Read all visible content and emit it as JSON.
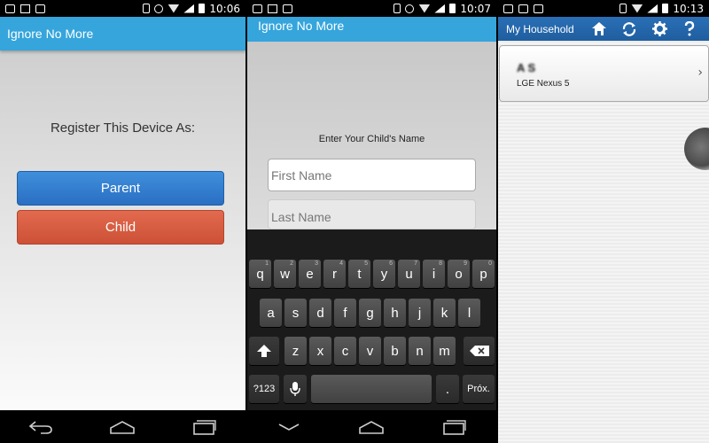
{
  "status_times": [
    "10:06",
    "10:07",
    "10:13"
  ],
  "screen1": {
    "app_title": "Ignore No More",
    "register_prompt": "Register This Device As:",
    "parent_label": "Parent",
    "child_label": "Child"
  },
  "screen2": {
    "app_title": "Ignore No More",
    "child_prompt": "Enter Your Child's Name",
    "first_placeholder": "First Name",
    "last_placeholder": "Last Name",
    "keyboard": {
      "row1": [
        [
          "q",
          "1"
        ],
        [
          "w",
          "2"
        ],
        [
          "e",
          "3"
        ],
        [
          "r",
          "4"
        ],
        [
          "t",
          "5"
        ],
        [
          "y",
          "6"
        ],
        [
          "u",
          "7"
        ],
        [
          "i",
          "8"
        ],
        [
          "o",
          "9"
        ],
        [
          "p",
          "0"
        ]
      ],
      "row2": [
        "a",
        "s",
        "d",
        "f",
        "g",
        "h",
        "j",
        "k",
        "l"
      ],
      "row3": [
        "z",
        "x",
        "c",
        "v",
        "b",
        "n",
        "m"
      ],
      "symbols_key": "?123",
      "period_key": ".",
      "next_key": "Próx."
    }
  },
  "screen3": {
    "title": "My Household",
    "device_name": "A      S   ",
    "device_model": "LGE Nexus 5"
  },
  "icons": {
    "home": "home-icon",
    "refresh": "refresh-icon",
    "settings": "gear-icon",
    "help": "help-icon",
    "back": "back-icon",
    "nav_home": "nav-home-icon",
    "recents": "recents-icon"
  },
  "colors": {
    "appbar_blue": "#35a5dc",
    "parent_blue": "#2f7ccf",
    "child_orange": "#d85c40",
    "household_bar": "#2467aa"
  }
}
